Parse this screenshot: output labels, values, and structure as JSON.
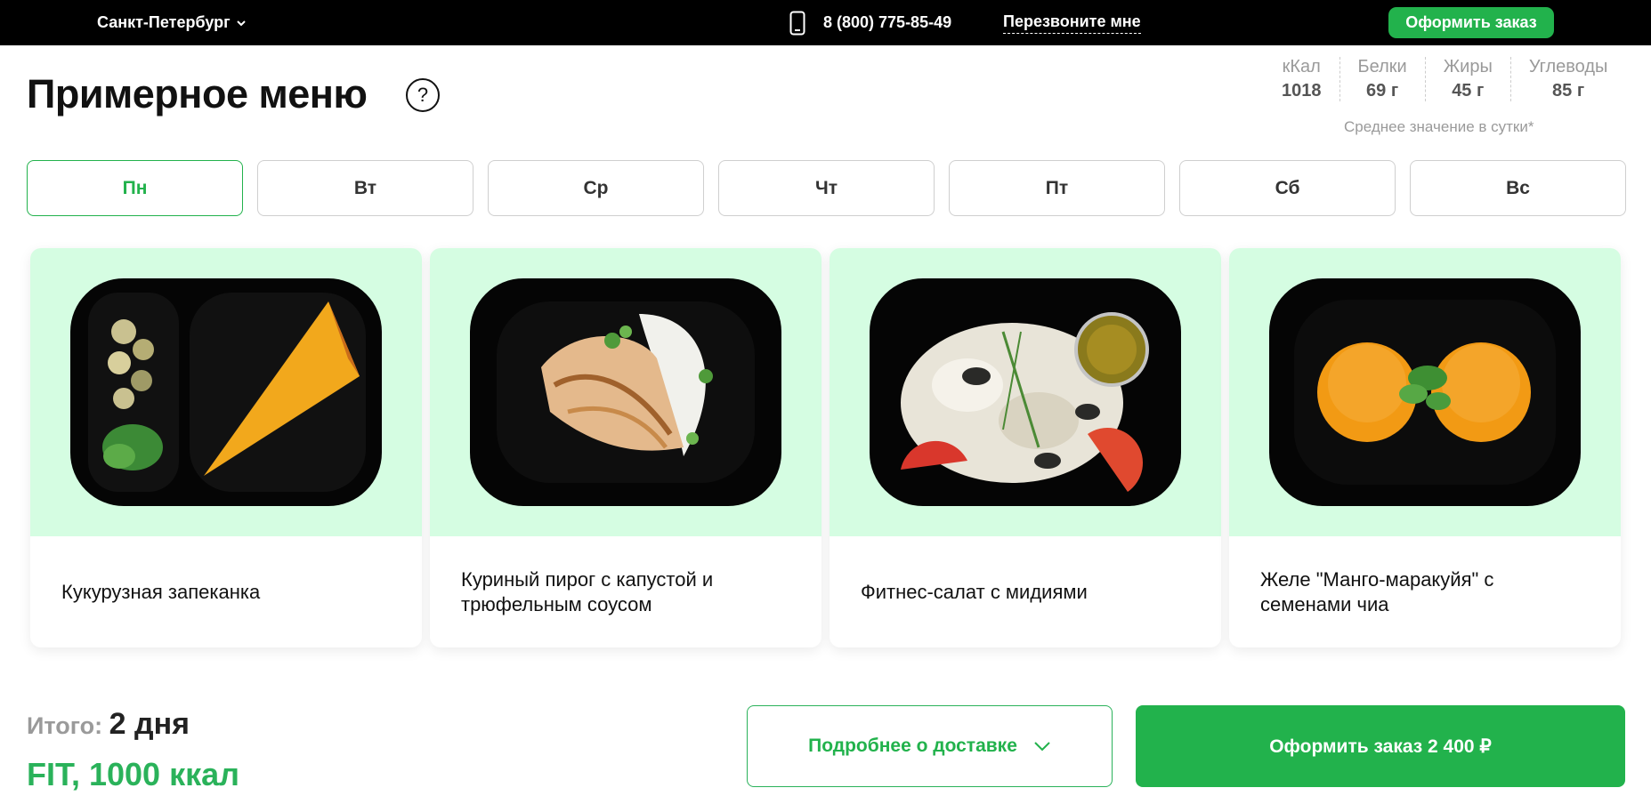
{
  "topbar": {
    "city": "Санкт-Петербург",
    "phone": "8 (800) 775-85-49",
    "callback": "Перезвоните мне",
    "order_button": "Оформить заказ"
  },
  "heading": {
    "title": "Примерное меню",
    "help": "?"
  },
  "nutrition": {
    "items": [
      {
        "label": "кКал",
        "value": "1018"
      },
      {
        "label": "Белки",
        "value": "69 г"
      },
      {
        "label": "Жиры",
        "value": "45 г"
      },
      {
        "label": "Углеводы",
        "value": "85 г"
      }
    ],
    "note": "Среднее значение в сутки*"
  },
  "days": [
    "Пн",
    "Вт",
    "Ср",
    "Чт",
    "Пт",
    "Сб",
    "Вс"
  ],
  "active_day": "Пн",
  "dishes": [
    {
      "name": "Кукурузная запеканка",
      "image": "corn-casserole-photo"
    },
    {
      "name": "Куриный пирог с капустой и трюфельным соусом",
      "image": "chicken-pie-photo"
    },
    {
      "name": "Фитнес-салат с мидиями",
      "image": "mussel-salad-photo"
    },
    {
      "name": "Желе \"Манго-маракуйя\" с семенами чиа",
      "image": "mango-jelly-photo"
    }
  ],
  "summary": {
    "total_label": "Итого:",
    "total_value": "2 дня",
    "plan": "FIT, 1000 ккал"
  },
  "actions": {
    "delivery": "Подробнее о доставке",
    "order": "Оформить заказ 2 400 ₽"
  },
  "colors": {
    "accent": "#22b24c",
    "card_bg": "#d5fde2",
    "topbar": "#000000"
  }
}
